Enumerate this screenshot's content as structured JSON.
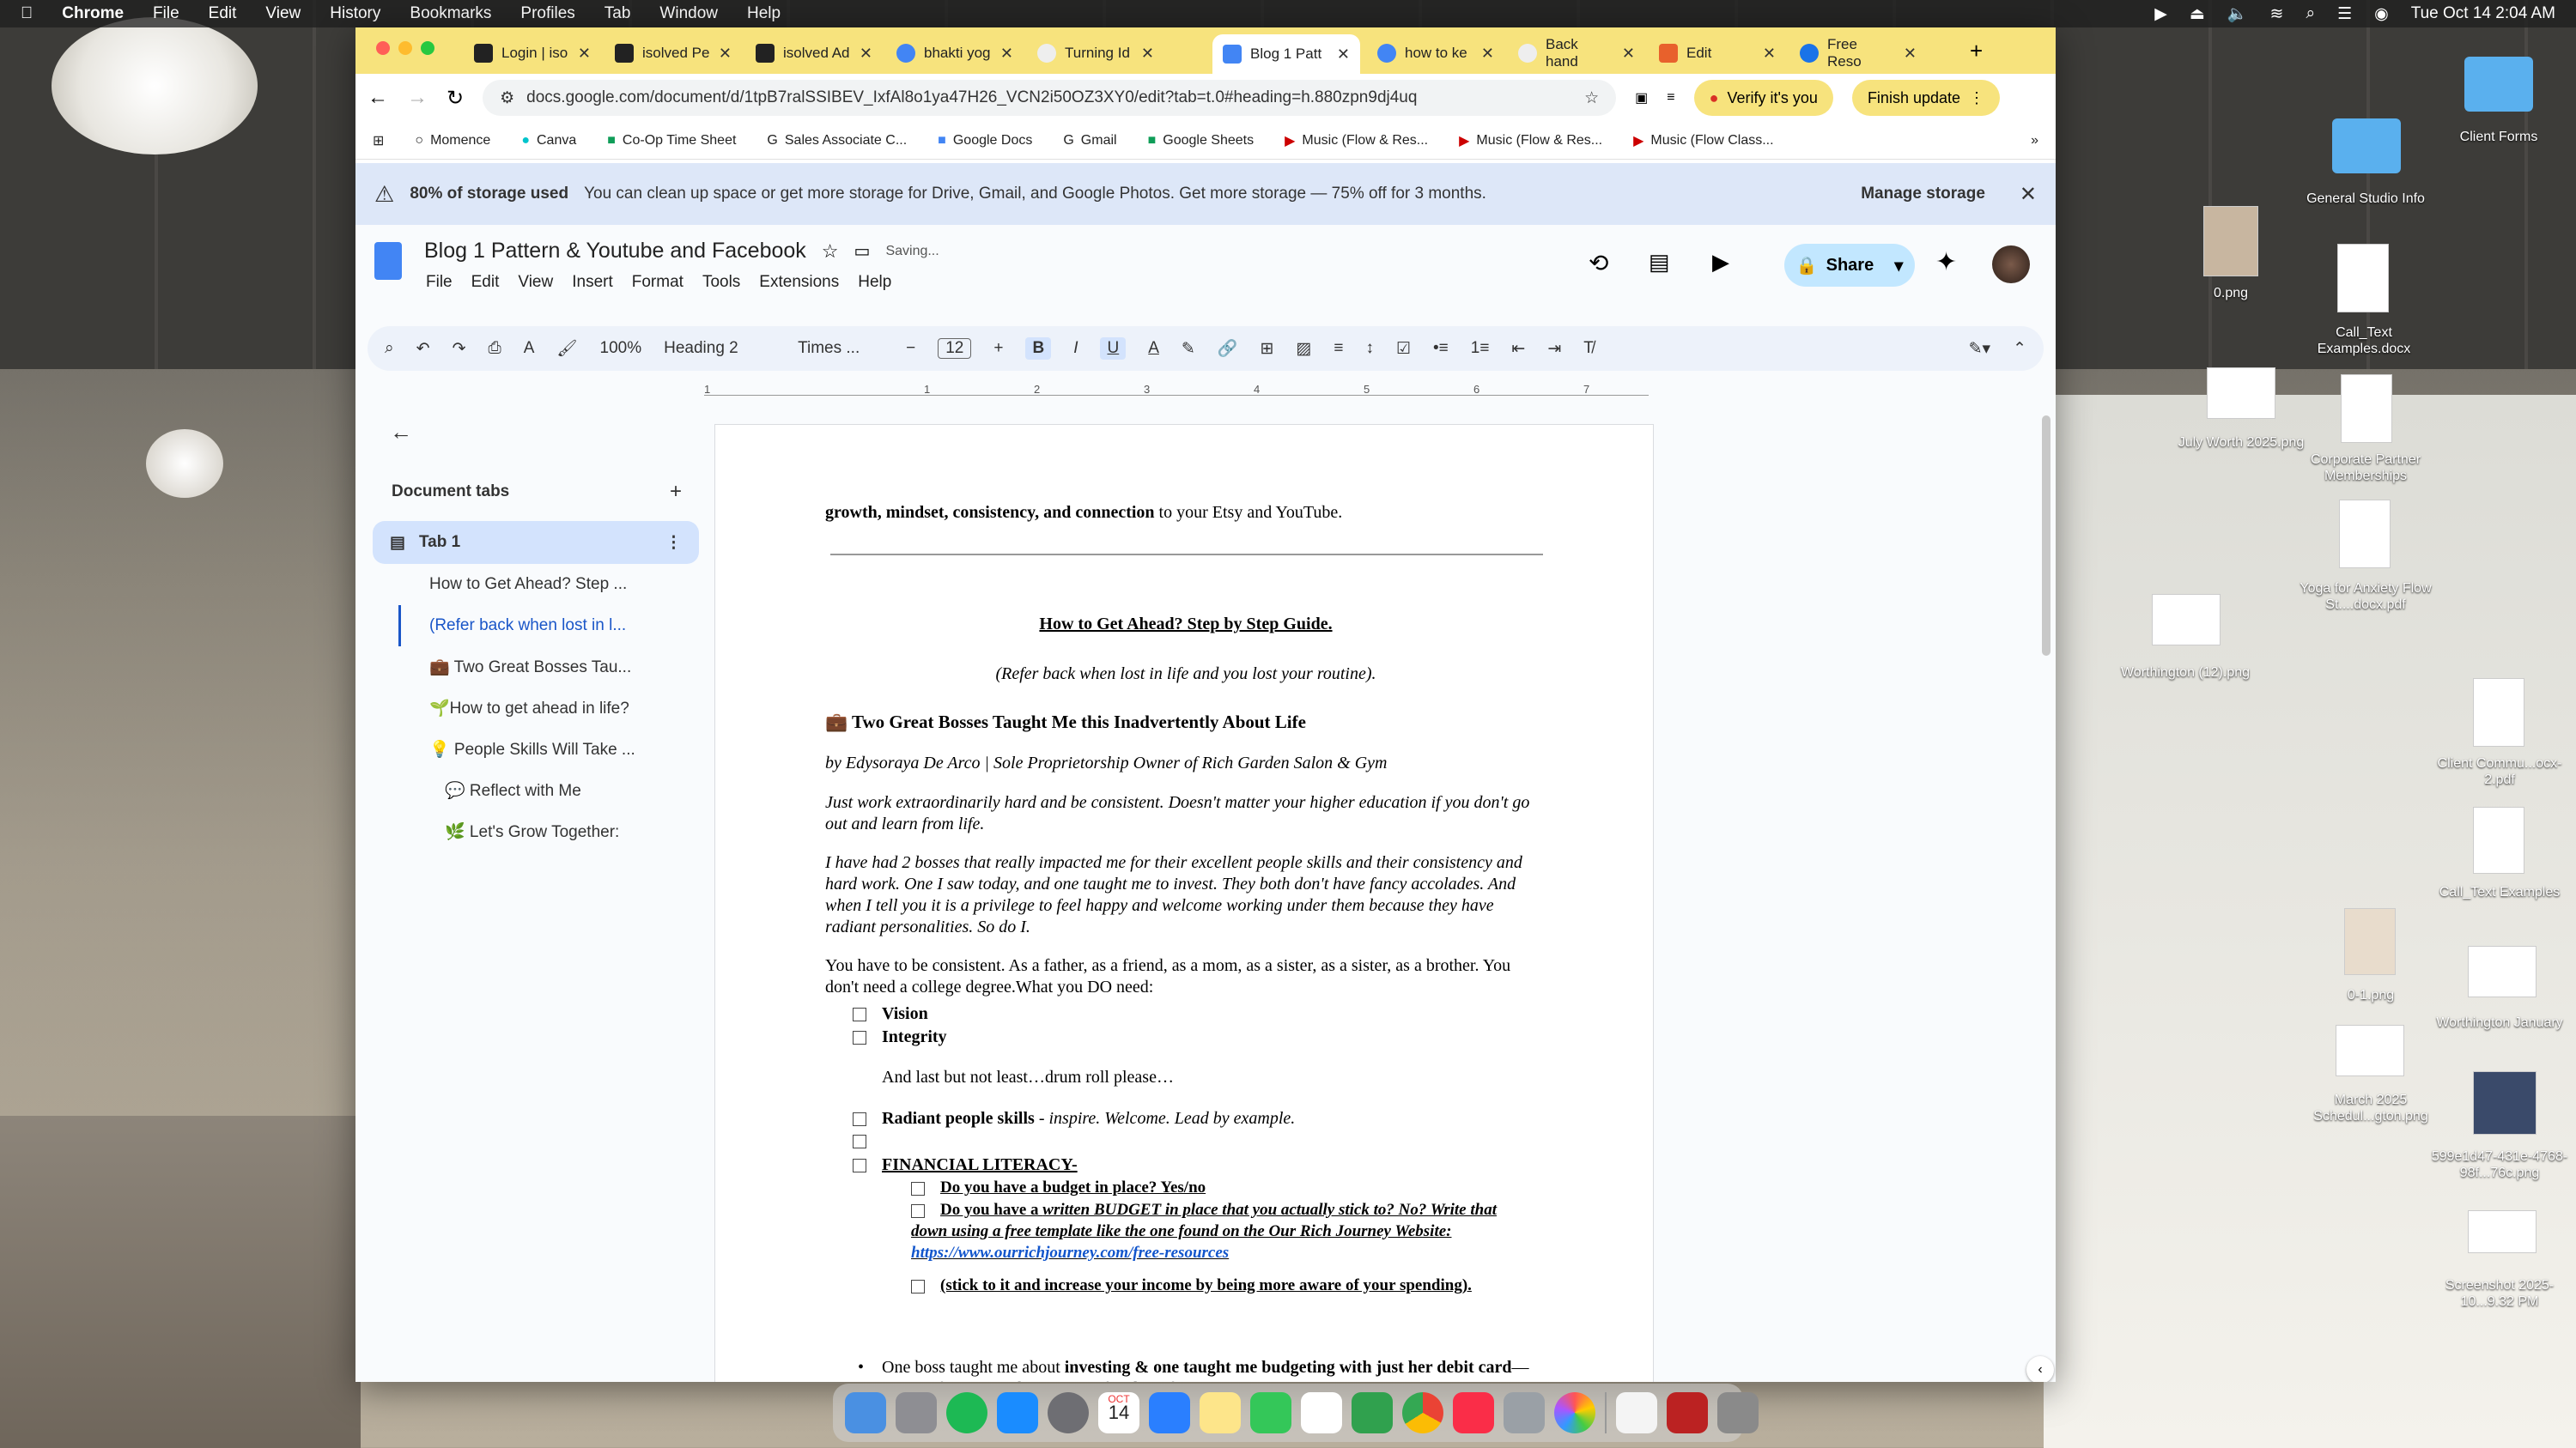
{
  "menubar": {
    "app": "Chrome",
    "items": [
      "File",
      "Edit",
      "View",
      "History",
      "Bookmarks",
      "Profiles",
      "Tab",
      "Window",
      "Help"
    ],
    "datetime": "Tue Oct 14  2:04 AM"
  },
  "tabs": [
    "Login | iso",
    "isolved Pe",
    "isolved Ad",
    "bhakti yog",
    "Turning Id",
    "Blog 1 Patt",
    "how to ke",
    "Back hand",
    "Edit",
    "Free Reso"
  ],
  "url": "docs.google.com/document/d/1tpB7ralSSIBEV_IxfAl8o1ya47H26_VCN2i50OZ3XY0/edit?tab=t.0#heading=h.880zpn9dj4uq",
  "verify_label": "Verify it's you",
  "finish_label": "Finish update",
  "bookmarks": [
    "Momence",
    "Canva",
    "Co-Op Time Sheet",
    "Sales Associate C...",
    "Google Docs",
    "Gmail",
    "Google Sheets",
    "Music (Flow & Res...",
    "Music (Flow & Res...",
    "Music (Flow Class..."
  ],
  "banner": {
    "bold": "80% of storage used",
    "text": "You can clean up space or get more storage for Drive, Gmail, and Google Photos. Get more storage — 75% off for 3 months.",
    "action": "Manage storage"
  },
  "doc": {
    "title": "Blog 1 Pattern & Youtube and Facebook",
    "status": "Saving...",
    "menus": [
      "File",
      "Edit",
      "View",
      "Insert",
      "Format",
      "Tools",
      "Extensions",
      "Help"
    ],
    "share": "Share"
  },
  "format": {
    "zoom": "100%",
    "style": "Heading 2",
    "font": "Times ...",
    "size": "12"
  },
  "ruler": [
    "1",
    "1",
    "2",
    "3",
    "4",
    "5",
    "6",
    "7"
  ],
  "sidebar": {
    "heading": "Document tabs",
    "tab": "Tab 1",
    "items": [
      "How to Get Ahead? Step ...",
      "(Refer back when lost in l...",
      "💼 Two Great Bosses Tau...",
      "🌱How to get ahead in life?",
      "💡 People Skills Will Take ...",
      "💬 Reflect with Me",
      "🌿 Let's Grow Together:"
    ]
  },
  "page": {
    "l1_bold": "growth, mindset, consistency, and connection",
    "l1_rest": " to your Etsy and YouTube.",
    "h_title": "How to Get Ahead? Step by Step Guide.",
    "refer": "(Refer back when lost in life and you lost your routine).",
    "h2": "💼  Two Great Bosses Taught Me this Inadvertently About Life",
    "byline": "by Edysoraya De Arco | Sole Proprietorship Owner of Rich Garden Salon & Gym",
    "p1": "Just work extraordinarily hard and be consistent. Doesn't matter your higher education if you don't go out and learn from life.",
    "p2": "I have had 2 bosses that really impacted me for their excellent people skills and their consistency and hard work. One I saw today, and one taught me to invest. They both don't have fancy accolades. And when I tell you it is a privilege to feel happy and welcome working under them because they have radiant personalities. So do I.",
    "p3": "You have to be consistent. As a father, as a friend, as a mom, as a sister, as a sister, as a brother. You don't need a college degree.What you DO need:",
    "vision": "Vision",
    "integrity": "Integrity",
    "last": "And last but not least…drum roll please…",
    "radiant_b": "Radiant people skills",
    ".": ".",
    "radiant_i": " - inspire. Welcome. Lead by example.",
    "fin": "FINANCIAL LITERACY-",
    "q1": "Do you have a budget in place? Yes/no",
    "q2a": "Do you have a ",
    "q2b": "written BUDGET in place that you actually stick to? No? Write that down using a free template like the one found on the Our Rich Journey Website:  ",
    "q2link": "https://www.ourrichjourney.com/free-resources",
    "q3": "(stick to it and increase your income by being more aware of your spending).",
    "bullet_a": "One boss taught me about ",
    "bullet_b": "investing & one taught me budgeting with just her debit card",
    "bullet_c": "—not just financially, but in myself and my future."
  },
  "desktop": [
    "Client Forms",
    "General Studio Info",
    "0.png",
    "Call_Text Examples.docx",
    "July Worth 2025.png",
    "Corporate Partner Memberships",
    "Yoga for Anxiety Flow St....docx.pdf",
    "Worthington (12).png",
    "Client Commu...ocx-2.pdf",
    "Call_Text Examples",
    "0-1.png",
    "Worthington January",
    "March 2025 Schedul...gton.png",
    "599e1d47-431e-4768-98f...76c.png",
    "Screenshot 2025-10...9.32 PM"
  ],
  "dock_date": "14",
  "dock_month": "OCT"
}
